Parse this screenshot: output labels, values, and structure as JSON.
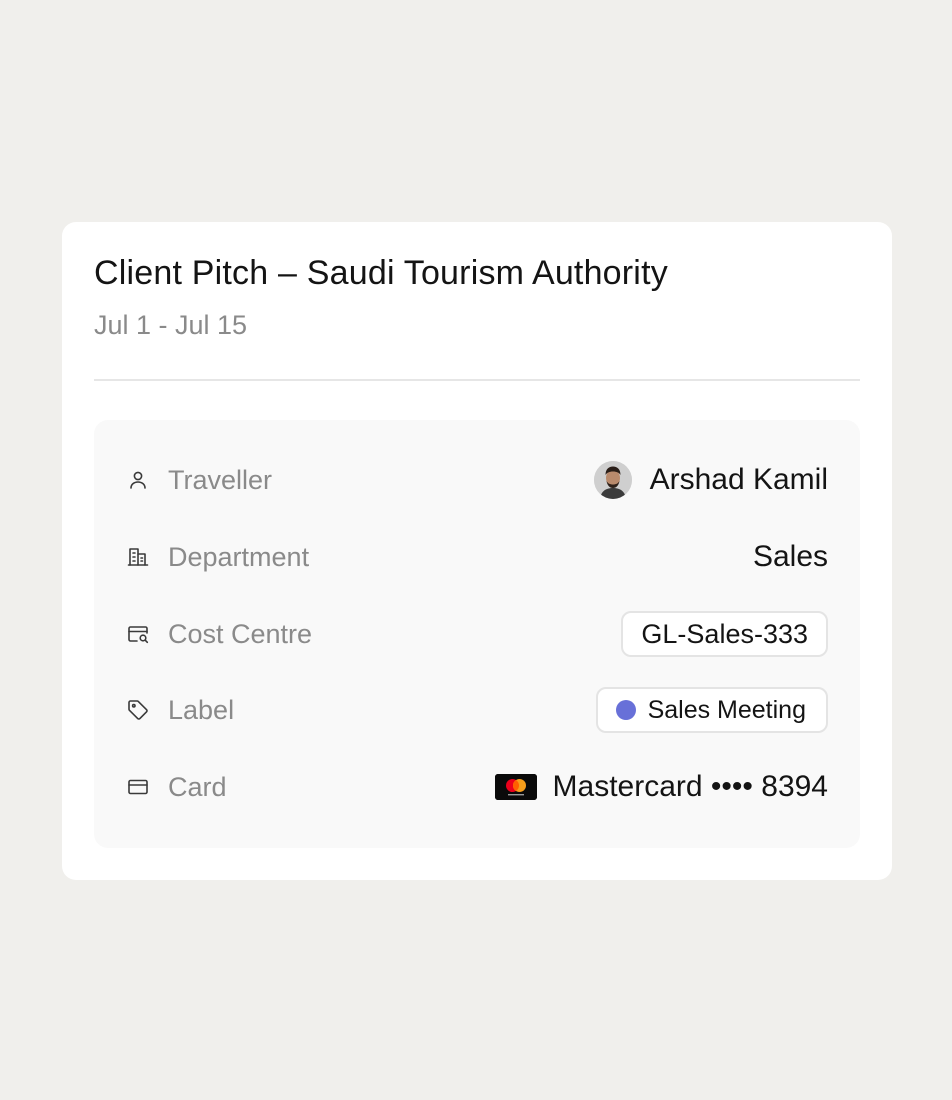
{
  "trip": {
    "title": "Client Pitch – Saudi Tourism Authority",
    "dates": "Jul 1 - Jul 15"
  },
  "details": {
    "traveller": {
      "label": "Traveller",
      "icon": "person-icon",
      "value": "Arshad Kamil"
    },
    "department": {
      "label": "Department",
      "icon": "building-icon",
      "value": "Sales"
    },
    "cost_centre": {
      "label": "Cost Centre",
      "icon": "cost-centre-icon",
      "value": "GL-Sales-333"
    },
    "label": {
      "label": "Label",
      "icon": "tag-icon",
      "value": "Sales Meeting",
      "dot_color": "#6870d8"
    },
    "card": {
      "label": "Card",
      "icon": "credit-card-icon",
      "value": "Mastercard •••• 8394"
    }
  },
  "colors": {
    "background": "#f0efec",
    "card": "#ffffff",
    "details_panel": "#f9f9f9",
    "label_text": "#8a8a8a",
    "value_text": "#141414",
    "label_dot": "#6870d8",
    "mastercard_red": "#eb001b",
    "mastercard_yellow": "#f79e1b"
  }
}
